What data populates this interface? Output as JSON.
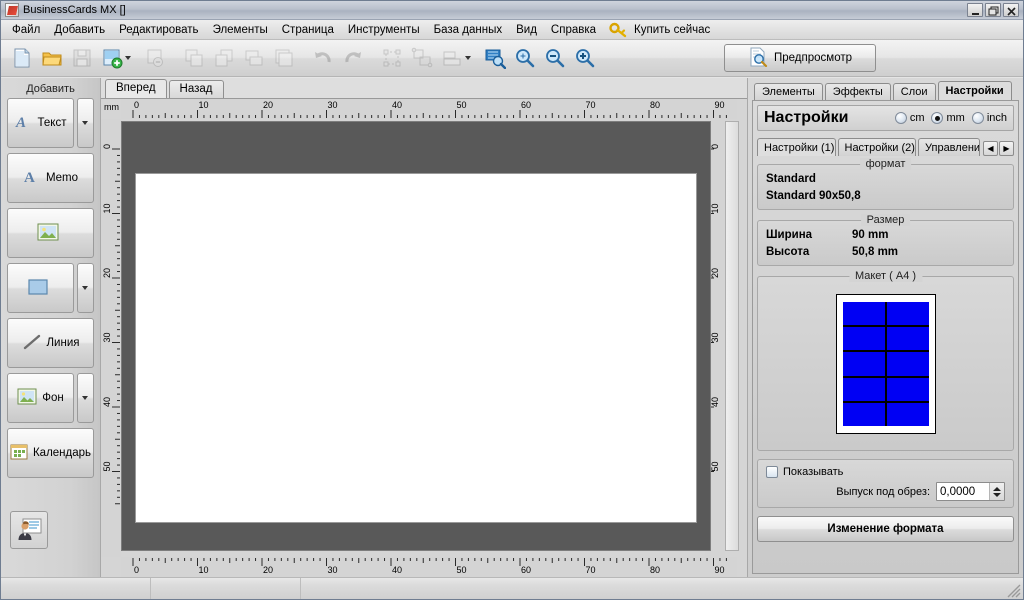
{
  "window": {
    "title": "BusinessCards MX []",
    "app_icon": "app-icon",
    "controls": {
      "minimize": "minimize-button",
      "restore": "restore-button",
      "close": "close-button"
    }
  },
  "menubar": {
    "items": [
      {
        "label": "Файл"
      },
      {
        "label": "Добавить"
      },
      {
        "label": "Редактировать"
      },
      {
        "label": "Элементы"
      },
      {
        "label": "Страница"
      },
      {
        "label": "Инструменты"
      },
      {
        "label": "База данных"
      },
      {
        "label": "Вид"
      },
      {
        "label": "Справка"
      }
    ],
    "buy_now": {
      "label": "Купить сейчас",
      "icon": "key-icon"
    }
  },
  "toolbar": {
    "buttons": [
      {
        "name": "new-document-button",
        "icon": "new-document-icon",
        "enabled": true
      },
      {
        "name": "open-document-button",
        "icon": "open-folder-icon",
        "enabled": true
      },
      {
        "name": "save-document-button",
        "icon": "save-disk-icon",
        "enabled": false
      },
      {
        "name": "add-page-button",
        "icon": "add-page-icon",
        "enabled": true,
        "has_dropdown": true
      },
      {
        "name": "remove-page-button",
        "icon": "remove-page-icon",
        "enabled": false
      },
      {
        "name": "copy-page-button",
        "icon": "copy-page-icon",
        "enabled": false
      },
      {
        "name": "paste-page-button",
        "icon": "paste-page-icon",
        "enabled": false
      },
      {
        "name": "duplicate-page-button",
        "icon": "duplicate-page-icon",
        "enabled": false
      },
      {
        "name": "pages-button",
        "icon": "pages-icon",
        "enabled": false
      },
      {
        "name": "undo-button",
        "icon": "undo-arrow-icon",
        "enabled": false
      },
      {
        "name": "redo-button",
        "icon": "redo-arrow-icon",
        "enabled": false
      },
      {
        "name": "select-all-button",
        "icon": "select-all-icon",
        "enabled": false
      },
      {
        "name": "group-objects-button",
        "icon": "group-objects-icon",
        "enabled": false
      },
      {
        "name": "align-button",
        "icon": "align-icon",
        "enabled": false,
        "has_dropdown": true
      },
      {
        "name": "zoom-fit-button",
        "icon": "zoom-fit-icon",
        "enabled": true
      },
      {
        "name": "zoom-actual-button",
        "icon": "zoom-actual-icon",
        "enabled": true
      },
      {
        "name": "zoom-out-button",
        "icon": "zoom-out-icon",
        "enabled": true
      },
      {
        "name": "zoom-in-button",
        "icon": "zoom-in-icon",
        "enabled": true
      }
    ],
    "preview": {
      "label": "Предпросмотр",
      "icon": "preview-icon"
    }
  },
  "left_dock": {
    "title": "Добавить",
    "items": [
      {
        "name": "add-text-button",
        "label": "Текст",
        "icon": "text-a-icon",
        "has_dropdown": true
      },
      {
        "name": "add-memo-button",
        "label": "Memo",
        "icon": "text-a-icon",
        "has_dropdown": false
      },
      {
        "name": "add-image-button",
        "label": "",
        "icon": "picture-icon",
        "has_dropdown": false
      },
      {
        "name": "add-shape-button",
        "label": "",
        "icon": "rectangle-icon",
        "has_dropdown": true
      },
      {
        "name": "add-line-button",
        "label": "Линия",
        "icon": "line-icon",
        "has_dropdown": false
      },
      {
        "name": "add-background-button",
        "label": "Фон",
        "icon": "picture-icon",
        "has_dropdown": true
      },
      {
        "name": "add-calendar-button",
        "label": "Календарь",
        "icon": "calendar-icon",
        "has_dropdown": false
      }
    ],
    "card_button": {
      "name": "business-card-button",
      "icon": "business-card-person-icon"
    }
  },
  "canvas": {
    "tabs": [
      {
        "label": "Вперед",
        "active": true
      },
      {
        "label": "Назад",
        "active": false
      }
    ],
    "ruler_unit": "mm",
    "ruler_h_ticks": [
      "0",
      "10",
      "20",
      "30",
      "40",
      "50",
      "60",
      "70",
      "80",
      "90"
    ],
    "ruler_v_ticks": [
      "0",
      "10",
      "20",
      "30",
      "40",
      "50"
    ]
  },
  "right_panel": {
    "tabs": [
      {
        "label": "Элементы",
        "active": false
      },
      {
        "label": "Эффекты",
        "active": false
      },
      {
        "label": "Слои",
        "active": false
      },
      {
        "label": "Настройки",
        "active": true
      }
    ],
    "header": "Настройки",
    "units": [
      {
        "label": "cm",
        "selected": false
      },
      {
        "label": "mm",
        "selected": true
      },
      {
        "label": "inch",
        "selected": false
      }
    ],
    "subtabs": [
      {
        "label": "Настройки (1)",
        "active": true
      },
      {
        "label": "Настройки (2)",
        "active": false
      },
      {
        "label": "Управлени",
        "active": false
      }
    ],
    "subtab_scroll": {
      "prev": "◀",
      "next": "▶"
    },
    "format_group": {
      "legend": "формат",
      "name": "Standard",
      "variant": "Standard 90x50,8"
    },
    "size_group": {
      "legend": "Размер",
      "rows": [
        {
          "key": "Ширина",
          "value": "90 mm"
        },
        {
          "key": "Высота",
          "value": "50,8 mm"
        }
      ]
    },
    "layout_group": {
      "legend": "Макет ( A4 )",
      "columns": 2,
      "rows": 5,
      "cell_color": "#0000f4",
      "page_color": "#ffffff"
    },
    "bleed_group": {
      "checkbox_label": "Показывать",
      "checkbox_checked": false,
      "field_label": "Выпуск под обрез:",
      "field_value": "0,0000"
    },
    "change_format_button": "Изменение формата"
  },
  "status_bar": {
    "panes": [
      "",
      "",
      ""
    ],
    "grip": "resize-grip"
  },
  "colors": {
    "accent_blue": "#0000f4",
    "canvas_gray": "#595959",
    "page_white": "#ffffff",
    "chrome": "#d4d4d4"
  }
}
